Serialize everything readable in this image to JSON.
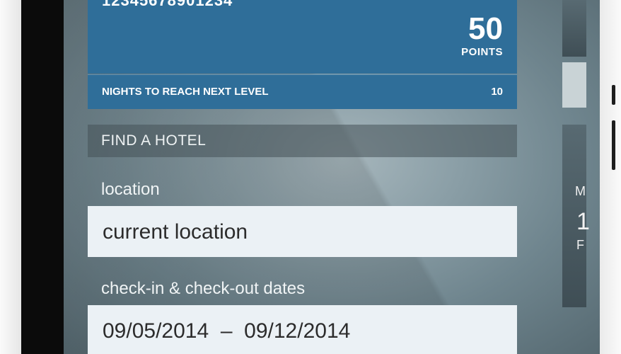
{
  "loyalty": {
    "member_number": "12345678901234",
    "points_value": "50",
    "points_label": "POINTS",
    "nights_label": "NIGHTS TO REACH NEXT LEVEL",
    "nights_value": "10"
  },
  "find_hotel": {
    "title": "FIND A HOTEL",
    "location_label": "location",
    "location_value": "current location",
    "dates_label": "check-in & check-out dates",
    "dates_value": "09/05/2014  –  09/12/2014"
  },
  "side_card": {
    "letter_top": "M",
    "letter_mid": "1",
    "letter_bot": "F"
  },
  "colors": {
    "card_blue": "#2f6e99",
    "field_bg": "#ebf1f5"
  }
}
